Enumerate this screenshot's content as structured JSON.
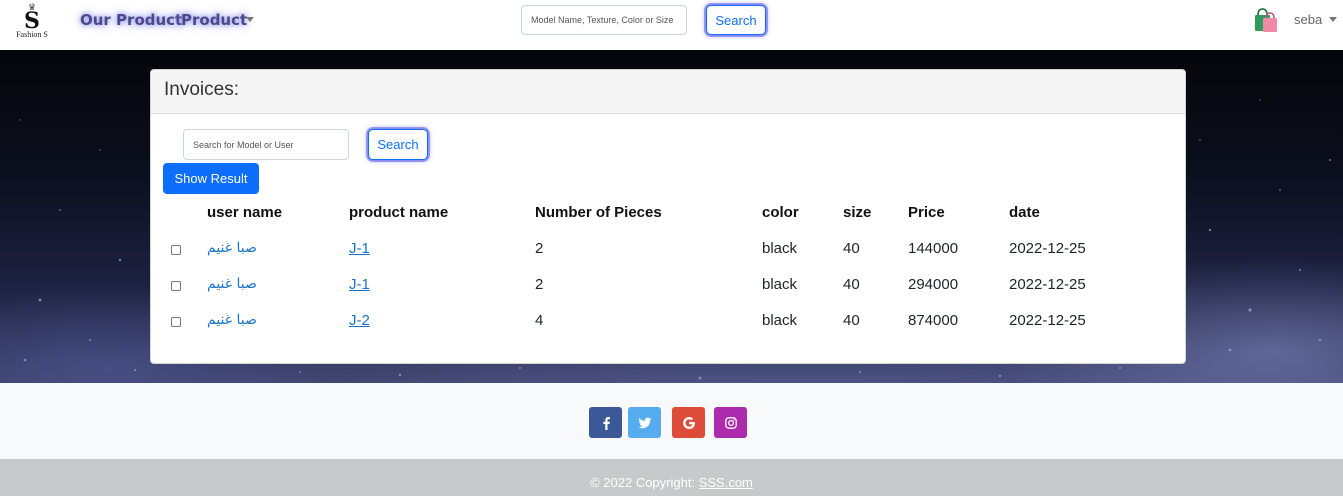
{
  "navbar": {
    "logo_text": "Fashion S",
    "logo_letter": "S",
    "our_product_label": "Our Product",
    "product_label": "Product",
    "search_placeholder": "Model Name, Texture, Color or Size",
    "search_button": "Search",
    "user_name": "seba",
    "cart_icon": "shopping-bag-icon"
  },
  "invoices": {
    "title": "Invoices:",
    "search_placeholder": "Search for Model or User",
    "search_button": "Search",
    "show_result_button": "Show Result",
    "columns": [
      "user name",
      "product name",
      "Number of Pieces",
      "color",
      "size",
      "Price",
      "date"
    ],
    "rows": [
      {
        "user": "صبا غنيم",
        "product": "J-1",
        "pieces": "2",
        "color": "black",
        "size": "40",
        "price": "144000",
        "date": "2022-12-25"
      },
      {
        "user": "صبا غنيم",
        "product": "J-1",
        "pieces": "2",
        "color": "black",
        "size": "40",
        "price": "294000",
        "date": "2022-12-25"
      },
      {
        "user": "صبا غنيم",
        "product": "J-2",
        "pieces": "4",
        "color": "black",
        "size": "40",
        "price": "874000",
        "date": "2022-12-25"
      }
    ]
  },
  "footer": {
    "social": [
      {
        "name": "facebook",
        "icon": "facebook-icon",
        "color": "#3b5998"
      },
      {
        "name": "twitter",
        "icon": "twitter-icon",
        "color": "#55acee"
      },
      {
        "name": "google",
        "icon": "google-icon",
        "color": "#dd4b39"
      },
      {
        "name": "instagram",
        "icon": "instagram-icon",
        "color": "#ac2bac"
      }
    ],
    "copyright_prefix": "© 2022 Copyright:",
    "copyright_link": "SSS.com"
  },
  "colors": {
    "accent": "#0d6efd",
    "link": "#1a73c8",
    "nav_text": "#4a4a8a"
  }
}
